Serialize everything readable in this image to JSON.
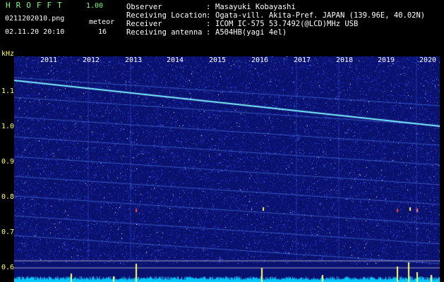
{
  "app": {
    "logo": "HROFFT",
    "version": "1.00",
    "filename": "0211202010.png",
    "timestamp": "02.11.20 20:10",
    "meteor_label": "meteor",
    "meteor_count": "16"
  },
  "info": [
    {
      "label": "Observer",
      "value": "Masayuki Kobayashi"
    },
    {
      "label": "Receiving Location",
      "value": "Ogata-vill. Akita-Pref. JAPAN (139.96E, 40.02N)"
    },
    {
      "label": "Receiver",
      "value": "ICOM IC-575 53.7492(@LCD)MHz USB"
    },
    {
      "label": "Receiving antenna",
      "value": "A504HB(yagi 4el)"
    }
  ],
  "axis": {
    "unit": "kHz",
    "years": [
      "2011",
      "2012",
      "2013",
      "2014",
      "2015",
      "2016",
      "2017",
      "2018",
      "2019",
      "2020"
    ],
    "freq_ticks": [
      "1.1",
      "1.0",
      "0.9",
      "0.8",
      "0.7",
      "0.6"
    ]
  },
  "colors": {
    "background": "#000000",
    "spectrogram": "#0a1270",
    "noise": "#3a5cff",
    "trace": "#7ff0ff",
    "label_green": "#7cff7c",
    "label_yellow": "#ffff66"
  }
}
